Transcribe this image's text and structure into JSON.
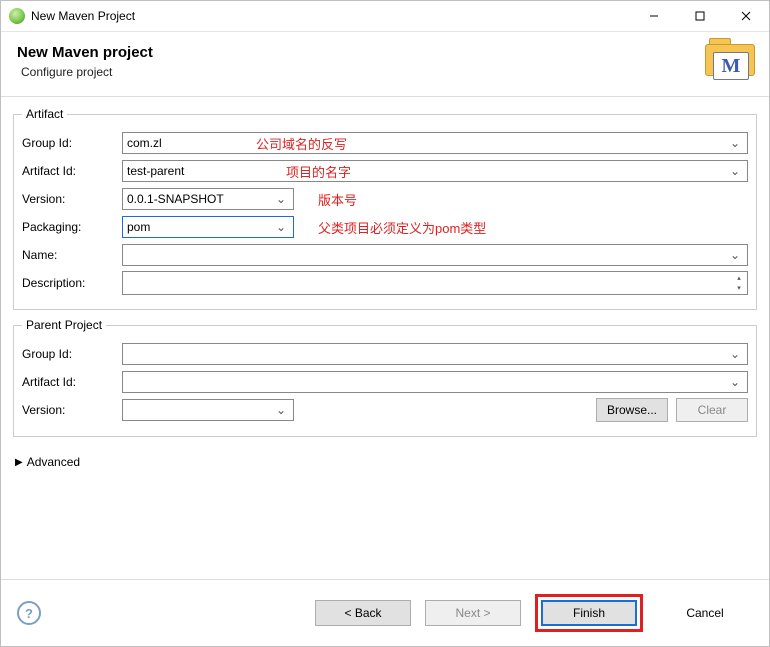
{
  "window": {
    "title": "New Maven Project"
  },
  "header": {
    "title": "New Maven project",
    "subtitle": "Configure project"
  },
  "artifact": {
    "legend": "Artifact",
    "group_id_label": "Group Id:",
    "group_id_value": "com.zl",
    "group_id_annot": "公司域名的反写",
    "artifact_id_label": "Artifact Id:",
    "artifact_id_value": "test-parent",
    "artifact_id_annot": "项目的名字",
    "version_label": "Version:",
    "version_value": "0.0.1-SNAPSHOT",
    "version_annot": "版本号",
    "packaging_label": "Packaging:",
    "packaging_value": "pom",
    "packaging_annot": "父类项目必须定义为pom类型",
    "name_label": "Name:",
    "name_value": "",
    "description_label": "Description:",
    "description_value": ""
  },
  "parent": {
    "legend": "Parent Project",
    "group_id_label": "Group Id:",
    "group_id_value": "",
    "artifact_id_label": "Artifact Id:",
    "artifact_id_value": "",
    "version_label": "Version:",
    "version_value": "",
    "browse_label": "Browse...",
    "clear_label": "Clear"
  },
  "advanced": {
    "label": "Advanced"
  },
  "footer": {
    "back": "< Back",
    "next": "Next >",
    "finish": "Finish",
    "cancel": "Cancel"
  }
}
